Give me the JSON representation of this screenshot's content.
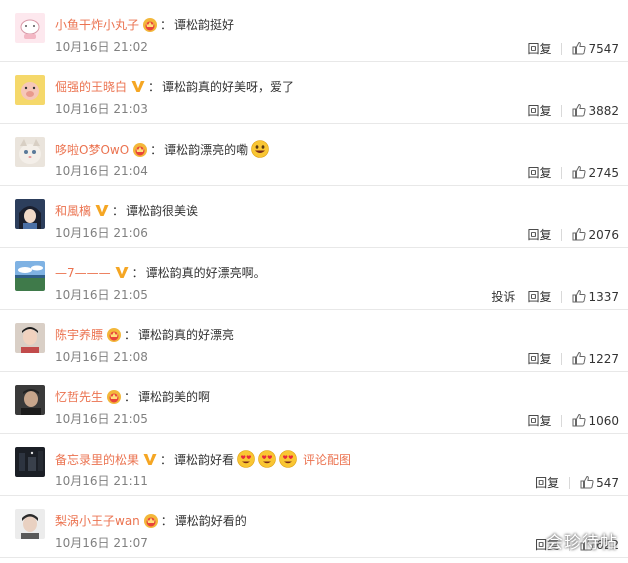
{
  "comments": [
    {
      "username": "小鱼干炸小丸子",
      "badge": "crown",
      "colon": "：",
      "text": "谭松韵挺好",
      "emojis": [],
      "pic_link": "",
      "time": "10月16日 21:02",
      "report": "",
      "reply": "回复",
      "likes": "7547",
      "avatar": "avatar-cartoon-pink"
    },
    {
      "username": "倔强的王晓白",
      "badge": "v",
      "colon": "：",
      "text": "谭松韵真的好美呀，爱了",
      "emojis": [],
      "pic_link": "",
      "time": "10月16日 21:03",
      "report": "",
      "reply": "回复",
      "likes": "3882",
      "avatar": "avatar-cartoon-pig"
    },
    {
      "username": "哆啦O梦OwO",
      "badge": "crown",
      "colon": "：",
      "text": "谭松韵漂亮的嘞",
      "emojis": [
        "grin-emoji"
      ],
      "pic_link": "",
      "time": "10月16日 21:04",
      "report": "",
      "reply": "回复",
      "likes": "2745",
      "avatar": "avatar-cat"
    },
    {
      "username": "和風樆",
      "badge": "v",
      "colon": "：",
      "text": "谭松韵很美诶",
      "emojis": [],
      "pic_link": "",
      "time": "10月16日 21:06",
      "report": "",
      "reply": "回复",
      "likes": "2076",
      "avatar": "avatar-anime"
    },
    {
      "username": "—7———",
      "badge": "v",
      "colon": "：",
      "text": "谭松韵真的好漂亮啊。",
      "emojis": [],
      "pic_link": "",
      "time": "10月16日 21:05",
      "report": "投诉",
      "reply": "回复",
      "likes": "1337",
      "avatar": "avatar-landscape"
    },
    {
      "username": "陈宇养膘",
      "badge": "crown",
      "colon": "：",
      "text": "谭松韵真的好漂亮",
      "emojis": [],
      "pic_link": "",
      "time": "10月16日 21:08",
      "report": "",
      "reply": "回复",
      "likes": "1227",
      "avatar": "avatar-portrait"
    },
    {
      "username": "忆哲先生",
      "badge": "crown",
      "colon": "：",
      "text": "谭松韵美的啊",
      "emojis": [],
      "pic_link": "",
      "time": "10月16日 21:05",
      "report": "",
      "reply": "回复",
      "likes": "1060",
      "avatar": "avatar-dark-man"
    },
    {
      "username": "备忘录里的松果",
      "badge": "v",
      "colon": "：",
      "text": "谭松韵好看",
      "emojis": [
        "heart-eyes-emoji",
        "heart-eyes-emoji",
        "heart-eyes-emoji"
      ],
      "pic_link": "评论配图",
      "time": "10月16日 21:11",
      "report": "",
      "reply": "回复",
      "likes": "547",
      "avatar": "avatar-night"
    },
    {
      "username": "梨涡小王子wan",
      "badge": "crown",
      "colon": "：",
      "text": "谭松韵好看的",
      "emojis": [],
      "pic_link": "",
      "time": "10月16日 21:07",
      "report": "",
      "reply": "回复",
      "likes": "622",
      "avatar": "avatar-boy"
    }
  ],
  "colors": {
    "username": "#eb7350",
    "text": "#333333",
    "time": "#808080",
    "divider": "#e8e8e8"
  },
  "watermark": "会珍待帖"
}
